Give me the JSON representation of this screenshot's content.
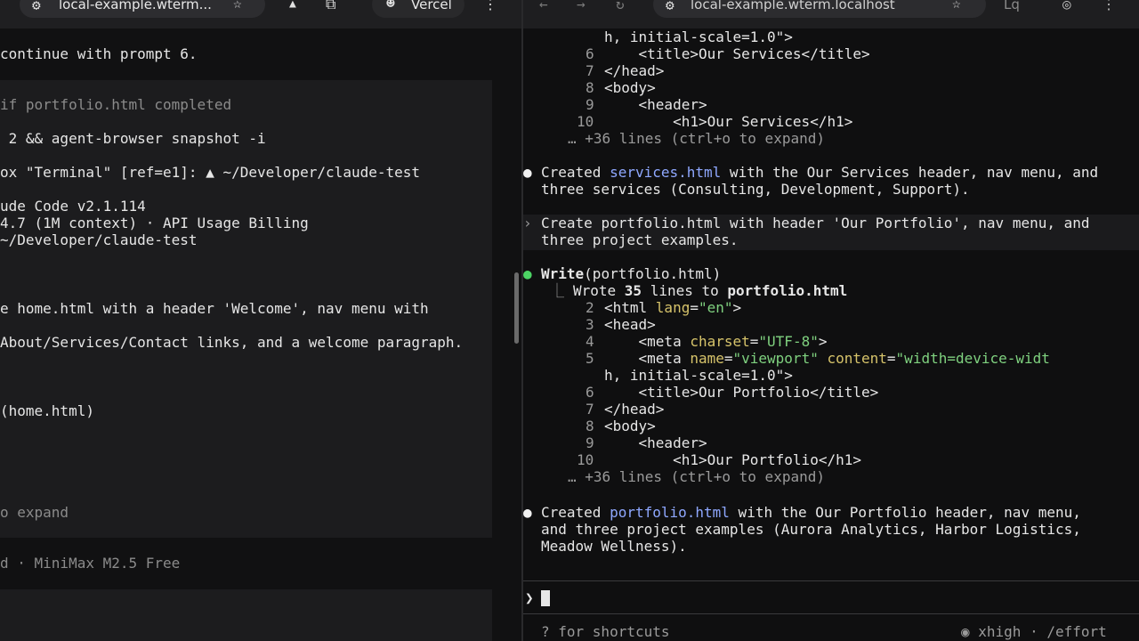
{
  "left_window": {
    "tab_title": "local-example.wterm...",
    "profile_label": "Vercel",
    "terminal_lines": [
      "continue with prompt 6.",
      "if portfolio.html completed",
      " 2 && agent-browser snapshot -i",
      "ox \"Terminal\" [ref=e1]: ▲ ~/Developer/claude-test",
      "ude Code v2.1.114",
      "4.7 (1M context) · API Usage Billing",
      "~/Developer/claude-test",
      "e home.html with a header 'Welcome', nav menu with",
      "About/Services/Contact links, and a welcome paragraph.",
      "(home.html)",
      "o expand",
      "d · MiniMax M2.5 Free"
    ]
  },
  "right_window": {
    "url": "local-example.wterm.localhost",
    "partial_icon_text": "Lq",
    "services_code": [
      {
        "num": "",
        "text": "h, initial-scale=1.0\">"
      },
      {
        "num": "6",
        "text": "    <title>Our Services</title>"
      },
      {
        "num": "7",
        "text": "</head>"
      },
      {
        "num": "8",
        "text": "<body>"
      },
      {
        "num": "9",
        "text": "    <header>"
      },
      {
        "num": "10",
        "text": "        <h1>Our Services</h1>"
      }
    ],
    "services_expand": "… +36 lines (ctrl+o to expand)",
    "services_created_line1_a": "Created ",
    "services_created_file": "services.html",
    "services_created_line1_b": " with the Our Services header, nav menu, and",
    "services_created_line2": "three services (Consulting, Development, Support).",
    "user_prompt_line1_a": "Create ",
    "user_prompt_file": "portfolio.html",
    "user_prompt_line1_b": " with header 'Our Portfolio', nav menu, and",
    "user_prompt_line2": "three project examples.",
    "write_tool": "Write",
    "write_arg": "(portfolio.html)",
    "wrote_prefix": "Wrote ",
    "wrote_count": "35",
    "wrote_mid": " lines to ",
    "wrote_file": "portfolio.html",
    "line2_num": "2",
    "line2_a": "<html ",
    "line2_attr": "lang",
    "line2_eq": "=",
    "line2_str": "\"en\"",
    "line2_b": ">",
    "line3_num": "3",
    "line3_text": "<head>",
    "line4_num": "4",
    "line4_a": "    <meta ",
    "line4_attr": "charset",
    "line4_eq": "=",
    "line4_str": "\"UTF-8\"",
    "line4_b": ">",
    "line5_num": "5",
    "line5_a": "    <meta ",
    "line5_attr1": "name",
    "line5_eq1": "=",
    "line5_str1": "\"viewport\"",
    "line5_sp": " ",
    "line5_attr2": "content",
    "line5_eq2": "=",
    "line5_str2": "\"width=device-widt",
    "line5_wrap": "h, initial-scale=1.0\">",
    "portfolio_code": [
      {
        "num": "6",
        "text": "    <title>Our Portfolio</title>"
      },
      {
        "num": "7",
        "text": "</head>"
      },
      {
        "num": "8",
        "text": "<body>"
      },
      {
        "num": "9",
        "text": "    <header>"
      },
      {
        "num": "10",
        "text": "        <h1>Our Portfolio</h1>"
      }
    ],
    "portfolio_expand": "… +36 lines (ctrl+o to expand)",
    "portfolio_created_line1_a": "Created ",
    "portfolio_created_file": "portfolio.html",
    "portfolio_created_line1_b": " with the Our Portfolio header, nav menu,",
    "portfolio_created_line2": "and three project examples (Aurora Analytics, Harbor Logistics,",
    "portfolio_created_line3": "Meadow Wellness).",
    "input_prompt": "❯",
    "footer_left": "? for shortcuts",
    "footer_right": "◉ xhigh · /effort"
  },
  "colors": {
    "accent_green": "#4cd464",
    "file_blue": "#8fa8ff",
    "string_green": "#7fd17f",
    "attr_yellow": "#d6c36a"
  }
}
